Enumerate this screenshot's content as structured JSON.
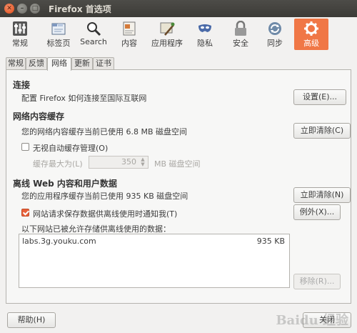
{
  "window": {
    "title": "Firefox 首选项",
    "close_glyph": "✕",
    "min_glyph": "–",
    "max_glyph": "□"
  },
  "toolbar": {
    "items": [
      {
        "label": "常规",
        "icon": "toggle-switches-icon"
      },
      {
        "label": "标签页",
        "icon": "tabs-icon"
      },
      {
        "label": "Search",
        "icon": "magnifier-icon"
      },
      {
        "label": "内容",
        "icon": "content-page-icon"
      },
      {
        "label": "应用程序",
        "icon": "applications-icon"
      },
      {
        "label": "隐私",
        "icon": "privacy-mask-icon"
      },
      {
        "label": "安全",
        "icon": "padlock-icon"
      },
      {
        "label": "同步",
        "icon": "sync-icon"
      },
      {
        "label": "高级",
        "icon": "gear-icon",
        "active": true
      }
    ],
    "accent": "#f07746"
  },
  "subtabs": [
    "常规",
    "反馈",
    "网络",
    "更新",
    "证书"
  ],
  "subtab_active": "网络",
  "connection": {
    "heading": "连接",
    "desc": "配置 Firefox 如何连接至国际互联网",
    "settings_button": "设置(E)..."
  },
  "cache": {
    "heading": "网络内容缓存",
    "status": "您的网络内容缓存当前已使用 6.8 MB 磁盘空间",
    "clear_button": "立即清除(C)",
    "override_label": "无视自动缓存管理(O)",
    "limit_label": "缓存最大为(L)",
    "limit_value": "350",
    "limit_unit": "MB 磁盘空间"
  },
  "offline": {
    "heading": "离线 Web 内容和用户数据",
    "status": "您的应用程序缓存当前已使用 935 KB 磁盘空间",
    "clear_button": "立即清除(N)",
    "notify_label": "网站请求保存数据供离线使用时通知我(T)",
    "exceptions_button": "例外(X)...",
    "allowed_label": "以下网站已被允许存储供离线使用的数据：",
    "sites": [
      {
        "host": "labs.3g.youku.com",
        "size": "935 KB"
      }
    ],
    "remove_button": "移除(R)..."
  },
  "footer": {
    "help_button": "帮助(H)",
    "close_button": "关闭"
  },
  "watermark": "Baidu 经验"
}
